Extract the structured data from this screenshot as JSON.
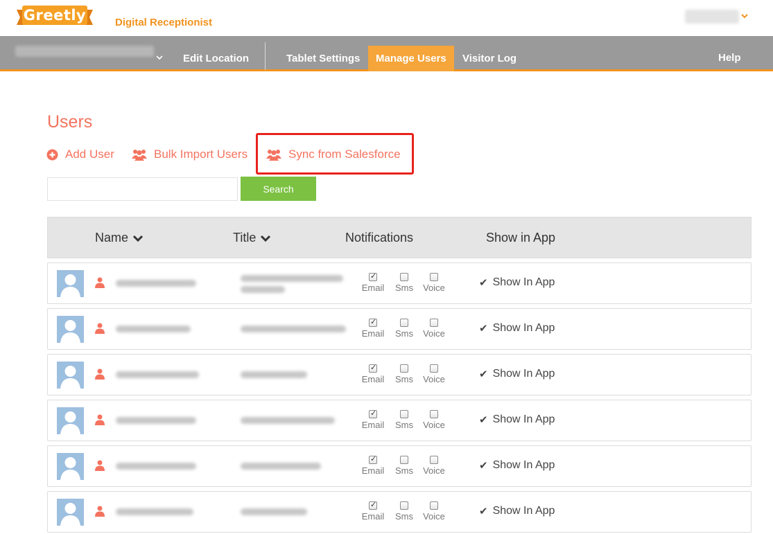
{
  "header": {
    "logo_text": "Greetly",
    "product_name": "Digital Receptionist"
  },
  "nav": {
    "items": [
      {
        "label": "Edit Location"
      },
      {
        "label": "Tablet Settings"
      },
      {
        "label": "Manage Users",
        "active": true
      },
      {
        "label": "Visitor Log"
      },
      {
        "label": "Help"
      }
    ]
  },
  "page": {
    "title": "Users",
    "actions": {
      "add_user": "Add User",
      "bulk_import": "Bulk Import Users",
      "sync_salesforce": "Sync from Salesforce"
    },
    "search": {
      "value": "",
      "placeholder": "",
      "button_label": "Search"
    }
  },
  "table": {
    "columns": {
      "name": "Name",
      "title": "Title",
      "notifications": "Notifications",
      "show_in_app": "Show in App"
    },
    "notification_labels": {
      "email": "Email",
      "sms": "Sms",
      "voice": "Voice"
    },
    "rows": [
      {
        "email": true,
        "sms": false,
        "voice": false,
        "show_in_app": "Show In App"
      },
      {
        "email": true,
        "sms": false,
        "voice": false,
        "show_in_app": "Show In App"
      },
      {
        "email": true,
        "sms": false,
        "voice": false,
        "show_in_app": "Show In App"
      },
      {
        "email": true,
        "sms": false,
        "voice": false,
        "show_in_app": "Show In App"
      },
      {
        "email": true,
        "sms": false,
        "voice": false,
        "show_in_app": "Show In App"
      },
      {
        "email": true,
        "sms": false,
        "voice": false,
        "show_in_app": "Show In App"
      }
    ]
  },
  "colors": {
    "brand_orange": "#f0931e",
    "accent_coral": "#f4735f",
    "nav_gray": "#9a9a9a",
    "search_green": "#7cc142",
    "highlight_red": "#e8221c"
  }
}
